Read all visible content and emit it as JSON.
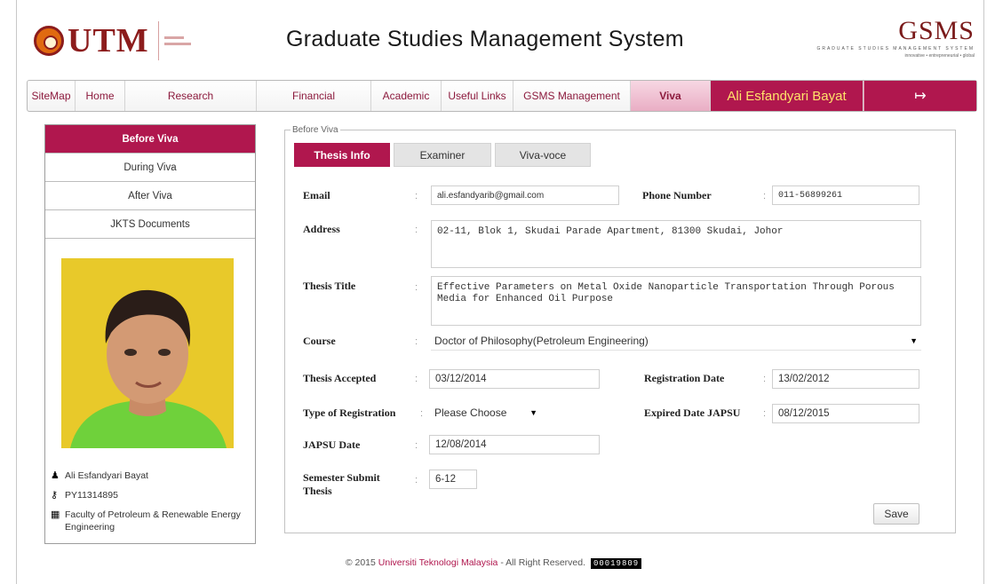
{
  "header": {
    "logo_text": "UTM",
    "title": "Graduate Studies Management System",
    "gsms_logo": "GSMS",
    "gsms_tagline": "GRADUATE STUDIES MANAGEMENT SYSTEM",
    "gsms_sub": "innovative • entrepreneurial • global"
  },
  "nav": {
    "items": [
      "SiteMap",
      "Home",
      "Research",
      "Financial",
      "Academic",
      "Useful Links",
      "GSMS Management",
      "Viva"
    ],
    "active": "Viva",
    "user": "Ali Esfandyari Bayat",
    "logout_icon": "logout-icon"
  },
  "sidebar": {
    "items": [
      "Before Viva",
      "During Viva",
      "After Viva",
      "JKTS Documents"
    ],
    "active": "Before Viva",
    "profile": {
      "name": "Ali Esfandyari Bayat",
      "id": "PY11314895",
      "faculty": "Faculty of Petroleum & Renewable Energy Engineering"
    }
  },
  "main": {
    "legend": "Before Viva",
    "tabs": [
      "Thesis Info",
      "Examiner",
      "Viva-voce"
    ],
    "active_tab": "Thesis Info",
    "colon": ":",
    "fields": {
      "email_label": "Email",
      "email": "ali.esfandyarib@gmail.com",
      "phone_label": "Phone Number",
      "phone": "011-56899261",
      "address_label": "Address",
      "address": "02-11, Blok 1, Skudai Parade Apartment, 81300 Skudai, Johor",
      "title_label": "Thesis Title",
      "title": "Effective Parameters on Metal Oxide Nanoparticle Transportation Through Porous Media for Enhanced Oil Purpose",
      "course_label": "Course",
      "course": "Doctor of Philosophy(Petroleum Engineering)",
      "accepted_label": "Thesis Accepted",
      "accepted": "03/12/2014",
      "reg_date_label": "Registration Date",
      "reg_date": "13/02/2012",
      "reg_type_label": "Type of Registration",
      "reg_type": "Please Choose",
      "expired_label": "Expired Date JAPSU",
      "expired": "08/12/2015",
      "japsu_label": "JAPSU Date",
      "japsu": "12/08/2014",
      "semester_label": "Semester Submit Thesis",
      "semester": "6-12"
    },
    "save_label": "Save"
  },
  "footer": {
    "prefix": "© 2015",
    "university": "Universiti Teknologi Malaysia",
    "suffix": "- All Right Reserved.",
    "counter": "00019809"
  }
}
